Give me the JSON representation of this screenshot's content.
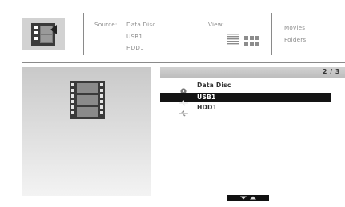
{
  "header": {
    "source_label": "Source:",
    "source_options": [
      "Data Disc",
      "USB1",
      "HDD1"
    ],
    "view_label": "View:",
    "view_modes": [
      "list-view-icon",
      "grid-view-icon"
    ],
    "content_options": [
      "Movies",
      "Folders"
    ]
  },
  "list": {
    "page_indicator": "2 / 3",
    "items": [
      {
        "label": "Data Disc",
        "icon": "disc-icon",
        "selected": false
      },
      {
        "label": "USB1",
        "icon": "usb-icon",
        "selected": true
      },
      {
        "label": "HDD1",
        "icon": "usb-icon",
        "selected": false
      }
    ]
  },
  "colors": {
    "selection": "#141414",
    "panel_gradient_top": "#c9c9c9",
    "panel_gradient_bottom": "#f3f3f3"
  }
}
